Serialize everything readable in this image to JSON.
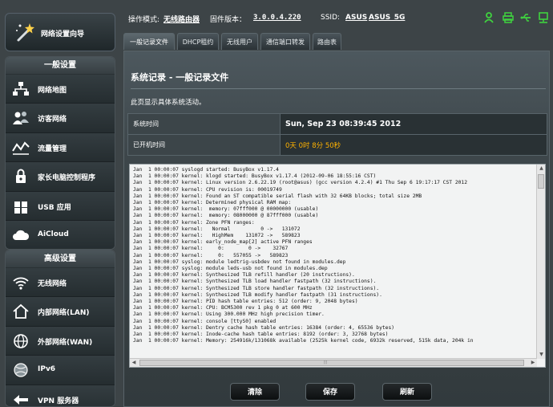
{
  "sidebar": {
    "wizard_label": "网络设置向导",
    "general": {
      "heading": "一般设置",
      "items": [
        {
          "label": "网络地图",
          "icon": "network-map-icon"
        },
        {
          "label": "访客网络",
          "icon": "guest-network-icon"
        },
        {
          "label": "流量管理",
          "icon": "traffic-manager-icon"
        },
        {
          "label": "家长电脑控制程序",
          "icon": "parental-control-icon"
        },
        {
          "label": "USB 应用",
          "icon": "usb-icon"
        },
        {
          "label": "AiCloud",
          "icon": "cloud-icon"
        }
      ]
    },
    "advanced": {
      "heading": "高级设置",
      "items": [
        {
          "label": "无线网络",
          "icon": "wireless-icon"
        },
        {
          "label": "内部网络(LAN)",
          "icon": "lan-icon"
        },
        {
          "label": "外部网络(WAN)",
          "icon": "wan-icon"
        },
        {
          "label": "IPv6",
          "icon": "ipv6-icon"
        },
        {
          "label": "VPN 服务器",
          "icon": "vpn-icon"
        }
      ]
    }
  },
  "status": {
    "mode_label": "操作模式:",
    "mode_value": "无线路由器",
    "firmware_label": "固件版本：",
    "firmware_value": "3.0.0.4.220",
    "ssid_label": "SSID:",
    "ssid_1": "ASUS",
    "ssid_2": "ASUS_5G",
    "icons": [
      "user-icon",
      "printer-icon",
      "usb-status-icon",
      "network-status-icon"
    ],
    "icon_color": "#3fd33f"
  },
  "tabs": [
    {
      "label": "一般记录文件",
      "active": true
    },
    {
      "label": "DHCP租约"
    },
    {
      "label": "无线用户"
    },
    {
      "label": "通信端口转发"
    },
    {
      "label": "路由表"
    }
  ],
  "page": {
    "title": "系统记录 - 一般记录文件",
    "description": "此页显示具体系统活动。",
    "system_time_label": "系统时间",
    "system_time_value": "Sun, Sep 23  08:39:45  2012",
    "uptime_label": "已开机时间",
    "uptime_value": "0天 0时 8分 50秒",
    "uptime_color": "#ffb200"
  },
  "log_lines": [
    "Jan  1 00:00:07 syslogd started: BusyBox v1.17.4",
    "Jan  1 00:00:07 kernel: klogd started: BusyBox v1.17.4 (2012-09-06 18:55:16 CST)",
    "Jan  1 00:00:07 kernel: Linux version 2.6.22.19 (root@asus) (gcc version 4.2.4) #1 Thu Sep 6 19:17:17 CST 2012",
    "Jan  1 00:00:07 kernel: CPU revision is: 00019749",
    "Jan  1 00:00:07 kernel: Found an ST compatible serial flash with 32 64KB blocks; total size 2MB",
    "Jan  1 00:00:07 kernel: Determined physical RAM map:",
    "Jan  1 00:00:07 kernel:  memory: 07fff000 @ 00000000 (usable)",
    "Jan  1 00:00:07 kernel:  memory: 08000000 @ 87fff000 (usable)",
    "Jan  1 00:00:07 kernel: Zone PFN ranges:",
    "Jan  1 00:00:07 kernel:   Normal          0 ->   131072",
    "Jan  1 00:00:07 kernel:   HighMem    131072 ->   589823",
    "Jan  1 00:00:07 kernel: early_node_map[2] active PFN ranges",
    "Jan  1 00:00:07 kernel:     0:        0 ->    32767",
    "Jan  1 00:00:07 kernel:     0:   557055 ->   589823",
    "Jan  1 00:00:07 syslog: module ledtrig-usbdev not found in modules.dep",
    "Jan  1 00:00:07 syslog: module leds-usb not found in modules.dep",
    "Jan  1 00:00:07 kernel: Synthesized TLB refill handler (20 instructions).",
    "Jan  1 00:00:07 kernel: Synthesized TLB load handler fastpath (32 instructions).",
    "Jan  1 00:00:07 kernel: Synthesized TLB store handler fastpath (32 instructions).",
    "Jan  1 00:00:07 kernel: Synthesized TLB modify handler fastpath (31 instructions).",
    "Jan  1 00:00:07 kernel: PID hash table entries: 512 (order: 9, 2048 bytes)",
    "Jan  1 00:00:07 kernel: CPU: BCM5300 rev 1 pkg 0 at 600 MHz",
    "Jan  1 00:00:07 kernel: Using 300.000 MHz high precision timer.",
    "Jan  1 00:00:07 kernel: console [ttyS0] enabled",
    "Jan  1 00:00:07 kernel: Dentry cache hash table entries: 16384 (order: 4, 65536 bytes)",
    "Jan  1 00:00:07 kernel: Inode-cache hash table entries: 8192 (order: 3, 32768 bytes)",
    "Jan  1 00:00:07 kernel: Memory: 254916k/131068k available (2525k kernel code, 6932k reserved, 515k data, 204k in"
  ],
  "buttons": {
    "clear": "清除",
    "save": "保存",
    "refresh": "刷新"
  }
}
